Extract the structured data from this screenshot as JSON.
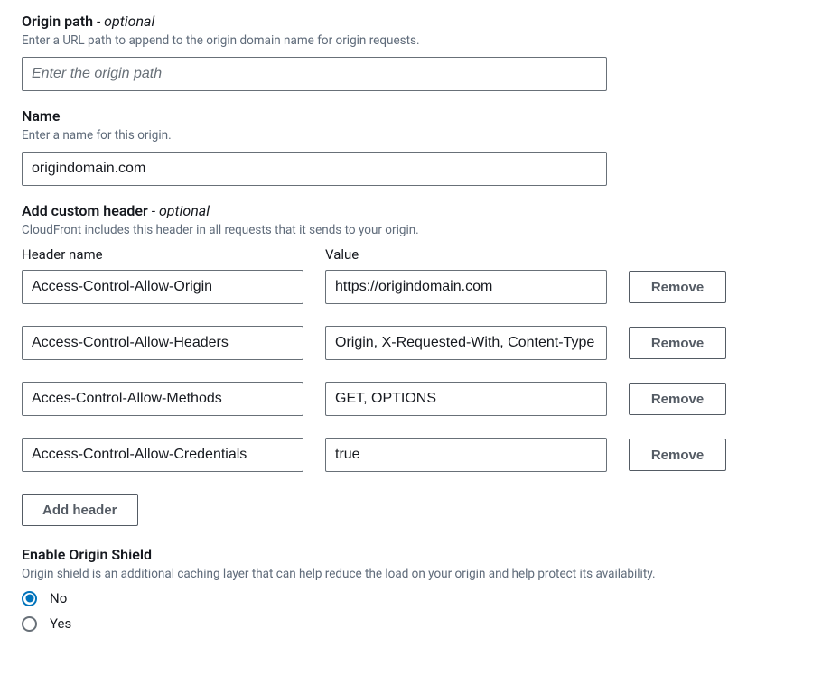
{
  "origin_path": {
    "label": "Origin path",
    "optional_suffix": " - optional",
    "desc": "Enter a URL path to append to the origin domain name for origin requests.",
    "placeholder": "Enter the origin path",
    "value": ""
  },
  "name": {
    "label": "Name",
    "desc": "Enter a name for this origin.",
    "value": "origindomain.com"
  },
  "custom_header": {
    "label": "Add custom header",
    "optional_suffix": " - optional",
    "desc": "CloudFront includes this header in all requests that it sends to your origin.",
    "col_name": "Header name",
    "col_value": "Value",
    "remove_label": "Remove",
    "add_label": "Add header",
    "rows": [
      {
        "name": "Access-Control-Allow-Origin",
        "value": "https://origindomain.com"
      },
      {
        "name": "Access-Control-Allow-Headers",
        "value": "Origin, X-Requested-With, Content-Type"
      },
      {
        "name": "Acces-Control-Allow-Methods",
        "value": "GET, OPTIONS"
      },
      {
        "name": "Access-Control-Allow-Credentials",
        "value": "true"
      }
    ]
  },
  "origin_shield": {
    "label": "Enable Origin Shield",
    "desc": "Origin shield is an additional caching layer that can help reduce the load on your origin and help protect its availability.",
    "options": {
      "no": "No",
      "yes": "Yes"
    },
    "selected": "no"
  }
}
